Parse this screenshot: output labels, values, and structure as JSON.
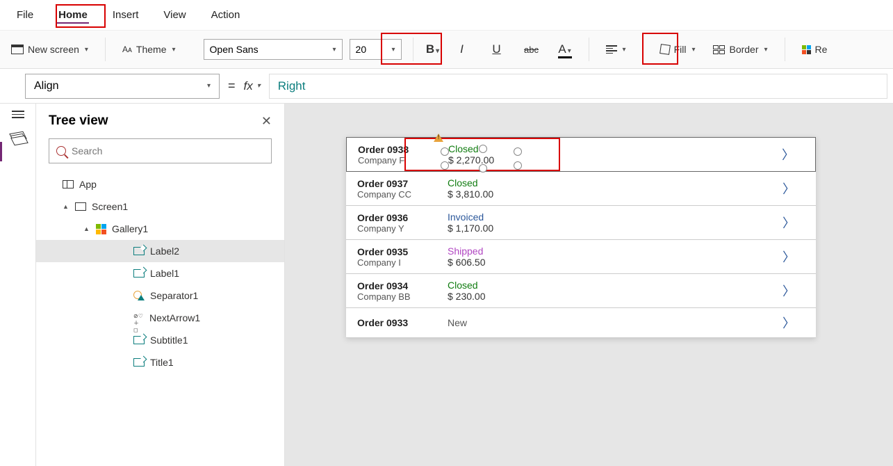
{
  "menu": {
    "file": "File",
    "home": "Home",
    "insert": "Insert",
    "view": "View",
    "action": "Action"
  },
  "ribbon": {
    "new_screen": "New screen",
    "theme": "Theme",
    "font_name": "Open Sans",
    "font_size": "20",
    "bold": "B",
    "italic": "I",
    "underline": "U",
    "strike": "abc",
    "font_color_letter": "A",
    "fill": "Fill",
    "border": "Border",
    "reorder": "Re"
  },
  "formula": {
    "property": "Align",
    "equals": "=",
    "fx": "fx",
    "value": "Right"
  },
  "tree": {
    "title": "Tree view",
    "search_placeholder": "Search",
    "items": {
      "app": "App",
      "screen1": "Screen1",
      "gallery1": "Gallery1",
      "label2": "Label2",
      "label1": "Label1",
      "separator1": "Separator1",
      "nextarrow1": "NextArrow1",
      "subtitle1": "Subtitle1",
      "title1": "Title1"
    }
  },
  "gallery": [
    {
      "order": "Order 0938",
      "company": "Company F",
      "status": "Closed",
      "price": "$ 2,270.00"
    },
    {
      "order": "Order 0937",
      "company": "Company CC",
      "status": "Closed",
      "price": "$ 3,810.00"
    },
    {
      "order": "Order 0936",
      "company": "Company Y",
      "status": "Invoiced",
      "price": "$ 1,170.00"
    },
    {
      "order": "Order 0935",
      "company": "Company I",
      "status": "Shipped",
      "price": "$ 606.50"
    },
    {
      "order": "Order 0934",
      "company": "Company BB",
      "status": "Closed",
      "price": "$ 230.00"
    },
    {
      "order": "Order 0933",
      "company": "",
      "status": "New",
      "price": ""
    }
  ]
}
